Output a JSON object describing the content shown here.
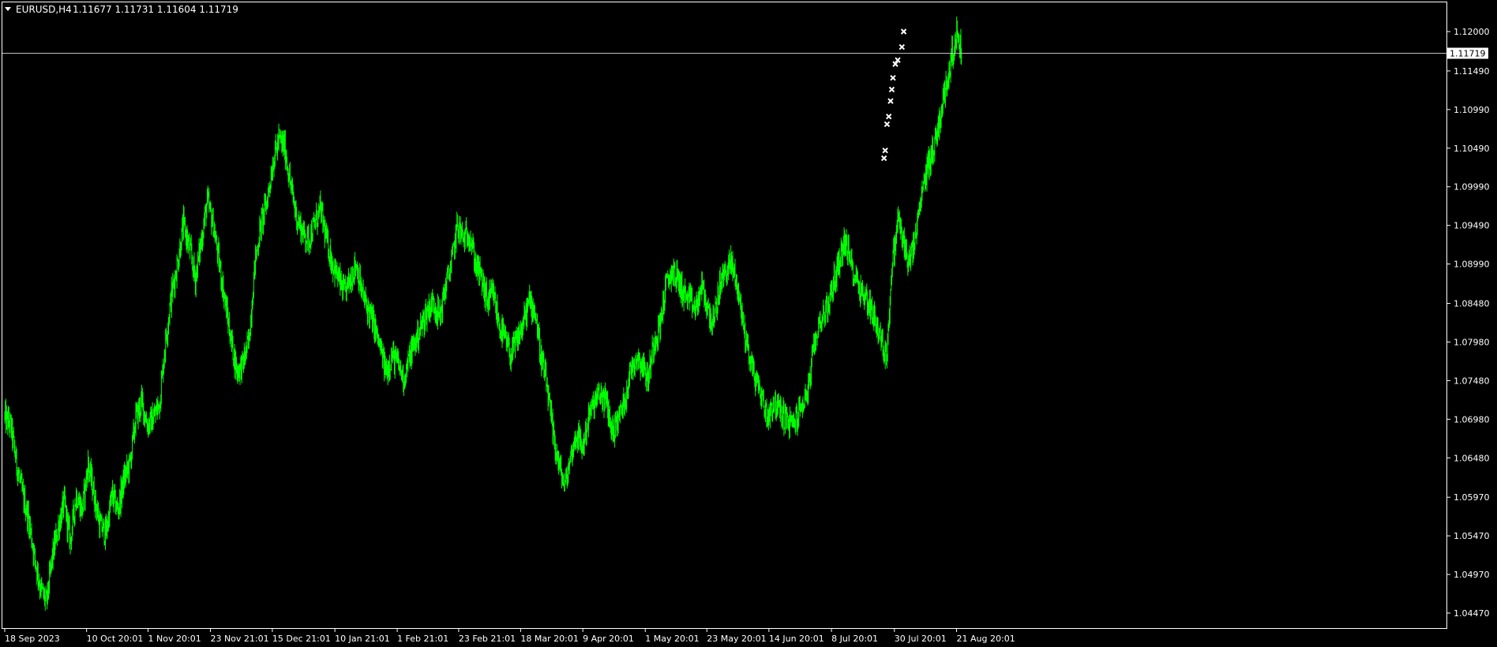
{
  "header": {
    "symbol_tf": "EURUSD,H4",
    "ohlc": "1.11677 1.11731 1.11604 1.11719"
  },
  "colors": {
    "background": "#000000",
    "frame": "#ffffff",
    "candles": "#00ff00",
    "price_line": "#c0c0c0",
    "markers": "#ffffff"
  },
  "chart_data": {
    "type": "line",
    "grid": false,
    "ylim": [
      1.042,
      1.1225
    ],
    "xlim": [
      0,
      100
    ],
    "y_ticks": [
      "1.12000",
      "1.11490",
      "1.10990",
      "1.10490",
      "1.09990",
      "1.09490",
      "1.08990",
      "1.08480",
      "1.07980",
      "1.07480",
      "1.06980",
      "1.06480",
      "1.05970",
      "1.05470",
      "1.04970",
      "1.04470"
    ],
    "x_ticks": [
      {
        "label": "18 Sep 2023",
        "pos": 0
      },
      {
        "label": "10 Oct 20:01",
        "pos": 6.87
      },
      {
        "label": "1 Nov 20:01",
        "pos": 12.03
      },
      {
        "label": "23 Nov 21:01",
        "pos": 17.26
      },
      {
        "label": "15 Dec 21:01",
        "pos": 22.46
      },
      {
        "label": "10 Jan 21:01",
        "pos": 27.71
      },
      {
        "label": "1 Feb 21:01",
        "pos": 32.94
      },
      {
        "label": "23 Feb 21:01",
        "pos": 38.1
      },
      {
        "label": "18 Mar 20:01",
        "pos": 43.3
      },
      {
        "label": "9 Apr 20:01",
        "pos": 48.52
      },
      {
        "label": "1 May 20:01",
        "pos": 53.76
      },
      {
        "label": "23 May 20:01",
        "pos": 58.93
      },
      {
        "label": "14 Jun 20:01",
        "pos": 64.14
      },
      {
        "label": "8 Jul 20:01",
        "pos": 69.39
      },
      {
        "label": "30 Jul 20:01",
        "pos": 74.67
      },
      {
        "label": "21 Aug 20:01",
        "pos": 79.89
      }
    ],
    "current_price": "1.11719",
    "current_value": 1.11719,
    "series": [
      {
        "x": [
          0,
          0.5,
          1.0,
          1.5,
          2.0,
          2.5,
          3.0,
          3.5,
          4.0,
          4.5,
          5.0,
          5.5,
          6.0,
          6.5,
          7.0,
          7.5,
          8.0,
          8.5,
          9.0,
          9.5,
          10.0,
          10.5,
          11.0,
          11.5,
          12.0,
          12.5,
          13.0,
          13.5,
          14.0,
          14.5,
          15.0,
          15.5,
          16.0,
          16.5,
          17.0,
          17.5,
          18.0,
          18.5,
          19.0,
          19.5,
          20.0,
          20.5,
          21.0,
          21.5,
          22.0,
          22.5,
          23.0,
          23.5,
          24.0,
          24.5,
          25.0,
          25.5,
          26.0,
          26.5,
          27.0,
          27.5,
          28.0,
          28.5,
          29.0,
          29.5,
          30.0,
          30.5,
          31.0,
          31.5,
          32.0,
          32.5,
          33.0,
          33.5,
          34.0,
          34.5,
          35.0,
          35.5,
          36.0,
          36.5,
          37.0,
          37.5,
          38.0,
          38.5,
          39.0,
          39.5,
          40.0,
          40.5,
          41.0,
          41.5,
          42.0,
          42.5,
          43.0,
          43.5,
          44.0,
          44.5,
          45.0,
          45.5,
          46.0,
          46.5,
          47.0,
          47.5,
          48.0,
          48.5,
          49.0,
          49.5,
          50.0,
          50.5,
          51.0,
          51.5,
          52.0,
          52.5,
          53.0,
          53.5,
          54.0,
          54.5,
          55.0,
          55.5,
          56.0,
          56.5,
          57.0,
          57.5,
          58.0,
          58.5,
          59.0,
          59.5,
          60.0,
          60.5,
          61.0,
          61.5,
          62.0,
          62.5,
          63.0,
          63.5,
          64.0,
          64.5,
          65.0,
          65.5,
          66.0,
          66.5,
          67.0,
          67.5,
          68.0,
          68.5,
          69.0,
          69.5,
          70.0,
          70.5,
          71.0,
          71.5,
          72.0,
          72.5,
          73.0,
          73.5,
          74.0,
          74.5,
          75.0,
          75.5,
          76.0,
          76.5,
          77.0,
          77.5,
          78.0,
          78.5,
          79.0,
          79.5,
          80.0,
          80.3
        ],
        "values": [
          1.07,
          1.069,
          1.064,
          1.06,
          1.057,
          1.052,
          1.048,
          1.046,
          1.052,
          1.056,
          1.059,
          1.054,
          1.06,
          1.058,
          1.064,
          1.06,
          1.056,
          1.055,
          1.06,
          1.058,
          1.062,
          1.064,
          1.07,
          1.072,
          1.069,
          1.07,
          1.072,
          1.08,
          1.086,
          1.09,
          1.095,
          1.092,
          1.088,
          1.093,
          1.098,
          1.095,
          1.09,
          1.085,
          1.08,
          1.076,
          1.077,
          1.08,
          1.09,
          1.095,
          1.098,
          1.103,
          1.106,
          1.105,
          1.1,
          1.096,
          1.094,
          1.093,
          1.095,
          1.097,
          1.093,
          1.09,
          1.088,
          1.086,
          1.088,
          1.09,
          1.086,
          1.084,
          1.082,
          1.079,
          1.076,
          1.078,
          1.077,
          1.075,
          1.078,
          1.08,
          1.082,
          1.084,
          1.085,
          1.083,
          1.087,
          1.09,
          1.095,
          1.093,
          1.094,
          1.09,
          1.088,
          1.085,
          1.086,
          1.082,
          1.08,
          1.078,
          1.08,
          1.082,
          1.085,
          1.084,
          1.078,
          1.074,
          1.068,
          1.064,
          1.061,
          1.065,
          1.068,
          1.066,
          1.07,
          1.072,
          1.073,
          1.072,
          1.068,
          1.07,
          1.072,
          1.076,
          1.078,
          1.077,
          1.075,
          1.08,
          1.082,
          1.087,
          1.089,
          1.088,
          1.086,
          1.085,
          1.084,
          1.087,
          1.084,
          1.082,
          1.087,
          1.089,
          1.09,
          1.087,
          1.082,
          1.078,
          1.075,
          1.073,
          1.07,
          1.072,
          1.071,
          1.07,
          1.069,
          1.07,
          1.072,
          1.074,
          1.08,
          1.083,
          1.084,
          1.087,
          1.09,
          1.093,
          1.09,
          1.088,
          1.086,
          1.085,
          1.083,
          1.08,
          1.078,
          1.09,
          1.096,
          1.092,
          1.09,
          1.094,
          1.099,
          1.103,
          1.105,
          1.109,
          1.113,
          1.117,
          1.12,
          1.117
        ]
      }
    ],
    "markers": {
      "x": [
        73.8,
        73.9,
        74.05,
        74.2,
        74.35,
        74.45,
        74.55,
        74.75,
        74.95,
        75.3,
        75.45
      ],
      "values": [
        1.1036,
        1.1046,
        1.108,
        1.109,
        1.111,
        1.1125,
        1.114,
        1.1158,
        1.1163,
        1.118,
        1.12
      ]
    }
  }
}
